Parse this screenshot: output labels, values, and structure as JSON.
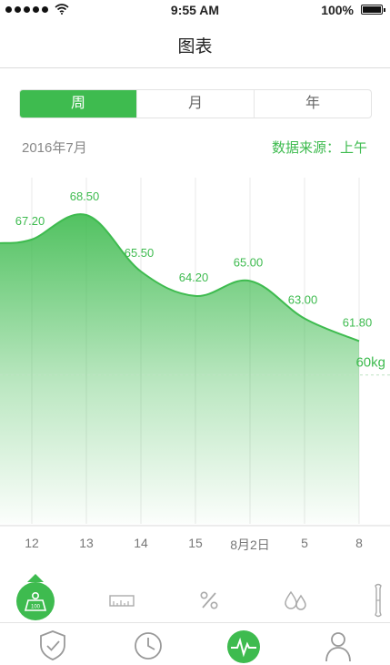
{
  "status_bar": {
    "time": "9:55 AM",
    "battery_pct": "100%",
    "signal_icon": "signal-dots-icon",
    "wifi_icon": "wifi-icon",
    "battery_icon": "battery-icon"
  },
  "nav": {
    "title": "图表"
  },
  "segments": [
    {
      "label": "周",
      "active": true
    },
    {
      "label": "月",
      "active": false
    },
    {
      "label": "年",
      "active": false
    }
  ],
  "date_label": "2016年7月",
  "source_label": "数据来源：上午",
  "colors": {
    "accent": "#3ebb4f",
    "gridline": "#e9e9e9",
    "target_line": "#bfe3c3"
  },
  "chart_data": {
    "type": "area",
    "x": [
      "12",
      "13",
      "14",
      "15",
      "8月2日",
      "5",
      "8"
    ],
    "values": [
      67.2,
      68.5,
      65.5,
      64.2,
      65.0,
      63.0,
      61.8
    ],
    "value_labels": [
      "67.20",
      "68.50",
      "65.50",
      "64.20",
      "65.00",
      "63.00",
      "61.80"
    ],
    "target": {
      "value": 60,
      "label": "60kg"
    },
    "ylim": [
      55,
      70
    ],
    "grid": true
  },
  "metric_icons": [
    {
      "name": "weight-scale-icon",
      "badge": "100",
      "active": true
    },
    {
      "name": "ruler-icon",
      "active": false
    },
    {
      "name": "percent-icon",
      "active": false
    },
    {
      "name": "water-drops-icon",
      "active": false
    },
    {
      "name": "bone-icon",
      "active": false
    }
  ],
  "tabbar": [
    {
      "name": "shield-check-icon",
      "active": false
    },
    {
      "name": "clock-icon",
      "active": false
    },
    {
      "name": "pulse-icon",
      "active": true
    },
    {
      "name": "person-icon",
      "active": false
    }
  ]
}
